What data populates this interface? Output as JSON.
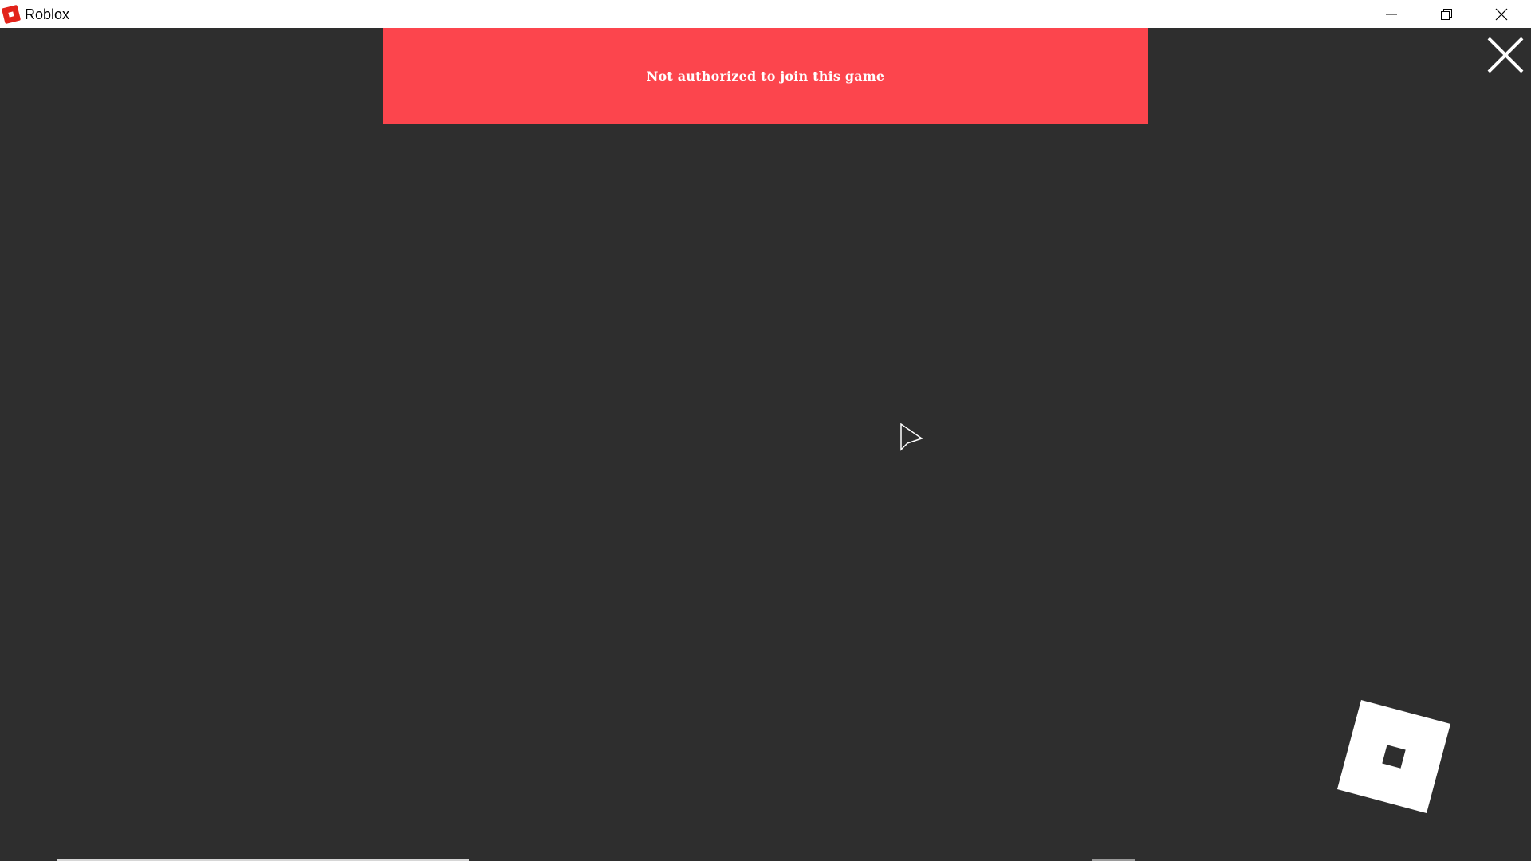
{
  "window": {
    "title": "Roblox",
    "icon": "roblox-logo-icon",
    "controls": {
      "minimize_icon": "minimize-icon",
      "restore_icon": "restore-icon",
      "close_icon": "close-icon"
    }
  },
  "banner": {
    "message": "Not authorized to join this game",
    "color": "#fc454d"
  },
  "overlay": {
    "close_icon": "close-icon",
    "loading_icon": "roblox-logo-icon"
  },
  "colors": {
    "background": "#2e2e2e",
    "titlebar": "#ffffff",
    "brand": "#e2231a"
  }
}
